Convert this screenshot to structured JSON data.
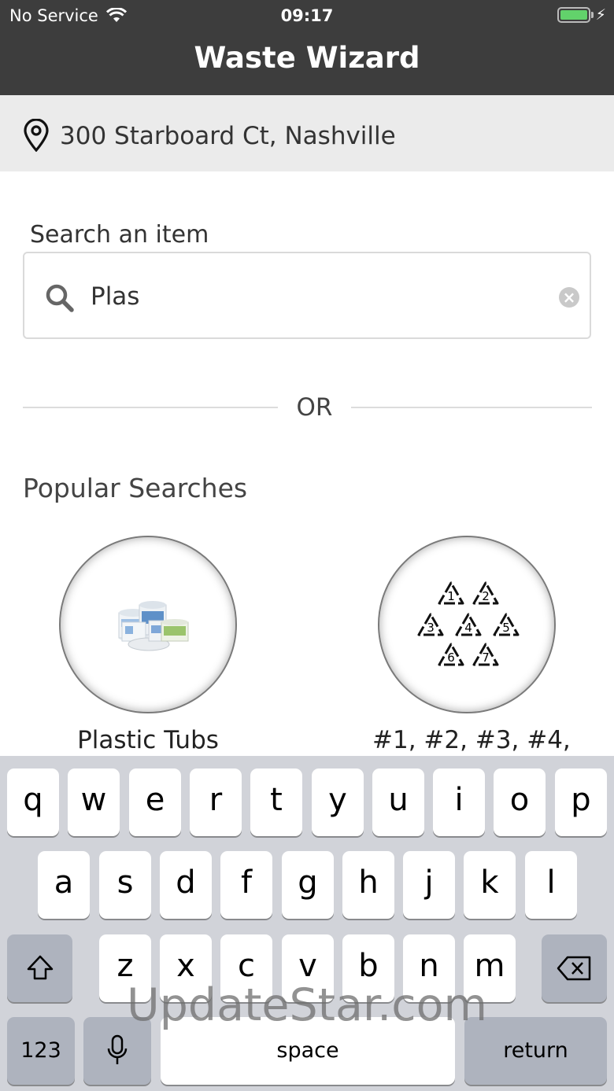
{
  "status_bar": {
    "carrier": "No Service",
    "time": "09:17"
  },
  "nav": {
    "title": "Waste Wizard"
  },
  "address": {
    "text": "300 Starboard Ct, Nashville"
  },
  "search": {
    "label": "Search an item",
    "value": "Plas"
  },
  "divider": {
    "text": "OR"
  },
  "popular": {
    "title": "Popular Searches",
    "items": [
      {
        "label": "Plastic Tubs",
        "icon": "plastic-tubs-image"
      },
      {
        "label": "#1, #2, #3, #4,",
        "icon": "recycling-codes-image"
      }
    ]
  },
  "keyboard": {
    "row1": [
      "q",
      "w",
      "e",
      "r",
      "t",
      "y",
      "u",
      "i",
      "o",
      "p"
    ],
    "row2": [
      "a",
      "s",
      "d",
      "f",
      "g",
      "h",
      "j",
      "k",
      "l"
    ],
    "row3": [
      "z",
      "x",
      "c",
      "v",
      "b",
      "n",
      "m"
    ],
    "numbers_key": "123",
    "space_key": "space",
    "return_key": "return"
  },
  "recycling_codes": [
    "1",
    "2",
    "3",
    "4",
    "5",
    "6",
    "7"
  ],
  "watermark": "UpdateStar.com",
  "colors": {
    "nav_bg": "#3d3d3d",
    "address_bg": "#ebebeb",
    "keyboard_bg": "#d1d3d9",
    "battery": "#62d26b"
  }
}
